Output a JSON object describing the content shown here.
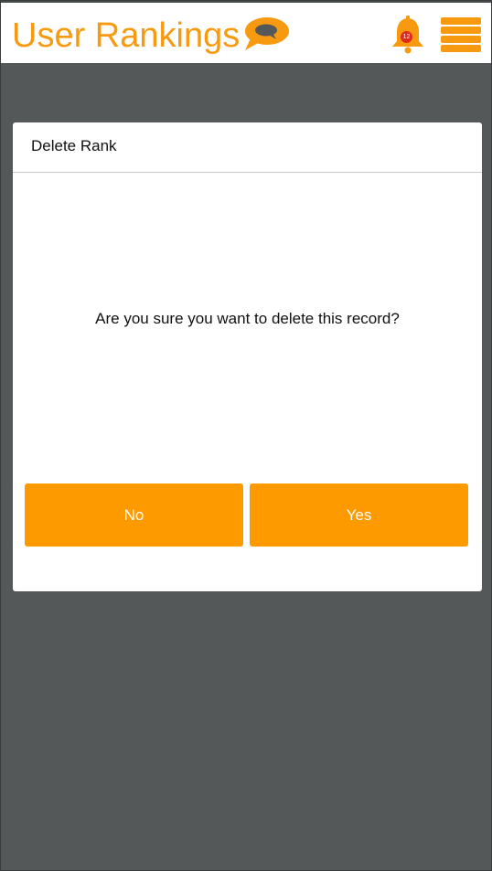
{
  "header": {
    "logo_text": "User Rankings",
    "logo_icon": "speech-bubble-icon",
    "notification_icon": "bell-icon",
    "notification_count": "12",
    "menu_icon": "hamburger-menu-icon"
  },
  "modal": {
    "title": "Delete Rank",
    "message": "Are you sure you want to delete this record?",
    "no_label": "No",
    "yes_label": "Yes"
  },
  "colors": {
    "accent": "#f79a10",
    "button": "#fd9a00",
    "overlay": "#545859",
    "badge": "#e02a1d"
  }
}
